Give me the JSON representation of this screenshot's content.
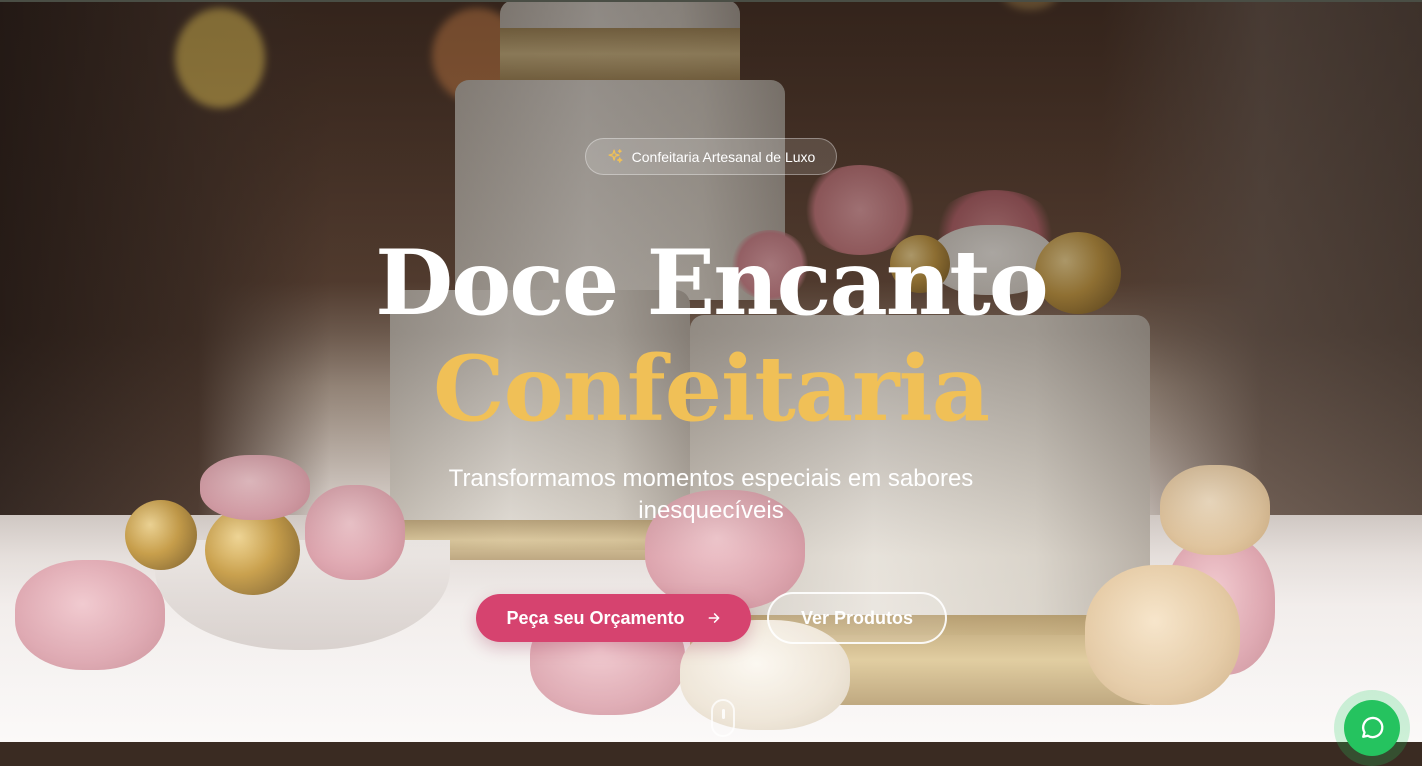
{
  "hero": {
    "badge": {
      "icon": "sparkles-icon",
      "label": "Confeitaria Artesanal de Luxo"
    },
    "title_line1": "Doce Encanto",
    "title_line2": "Confeitaria",
    "subtitle": "Transformamos momentos especiais em sabores inesquecíveis",
    "primary_button": {
      "label": "Peça seu Orçamento",
      "icon": "arrow-right-icon"
    },
    "secondary_button": {
      "label": "Ver Produtos"
    },
    "scroll_indicator": {
      "icon": "mouse-scroll-icon"
    }
  },
  "floating": {
    "whatsapp": {
      "icon": "whatsapp-icon"
    }
  },
  "colors": {
    "accent_gold": "#f0c057",
    "primary_pink": "#d6436f",
    "whatsapp_green": "#25c35f",
    "text_white": "#ffffff"
  }
}
